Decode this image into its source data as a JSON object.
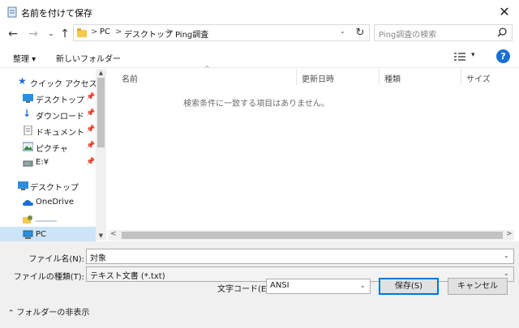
{
  "window": {
    "title": "名前を付けて保存"
  },
  "nav": {
    "breadcrumbs": [
      "PC",
      "デスクトップ",
      "Ping調査"
    ],
    "search_placeholder": "Ping調査の検索"
  },
  "toolbar": {
    "organize": "整理 ▾",
    "new_folder": "新しいフォルダー"
  },
  "sidebar": {
    "items": [
      {
        "label": "クイック アクセス",
        "icon": "star-icon"
      },
      {
        "label": "デスクトップ",
        "icon": "desktop-icon",
        "pinned": true
      },
      {
        "label": "ダウンロード",
        "icon": "download-icon",
        "pinned": true
      },
      {
        "label": "ドキュメント",
        "icon": "document-icon",
        "pinned": true
      },
      {
        "label": "ピクチャ",
        "icon": "picture-icon",
        "pinned": true
      },
      {
        "label": "E:¥",
        "icon": "drive-icon",
        "pinned": true
      },
      {
        "label": "デスクトップ",
        "icon": "desktop-icon"
      },
      {
        "label": "OneDrive",
        "icon": "cloud-icon"
      },
      {
        "label": "",
        "icon": "user-folder-icon"
      },
      {
        "label": "PC",
        "icon": "computer-icon",
        "selected": true
      }
    ]
  },
  "filelist": {
    "columns": [
      "名前",
      "更新日時",
      "種類",
      "サイズ"
    ],
    "empty_message": "検索条件に一致する項目はありません。"
  },
  "form": {
    "filename_label": "ファイル名(N):",
    "filename_value": "対象",
    "filetype_label": "ファイルの種類(T):",
    "filetype_value": "テキスト文書 (*.txt)",
    "hide_folders": "フォルダーの非表示",
    "encoding_label": "文字コード(E):",
    "encoding_value": "ANSI",
    "save_button": "保存(S)",
    "cancel_button": "キャンセル"
  },
  "colors": {
    "accent": "#0078d7",
    "selected_bg": "#cce4f7",
    "help": "#1a6fd4"
  }
}
